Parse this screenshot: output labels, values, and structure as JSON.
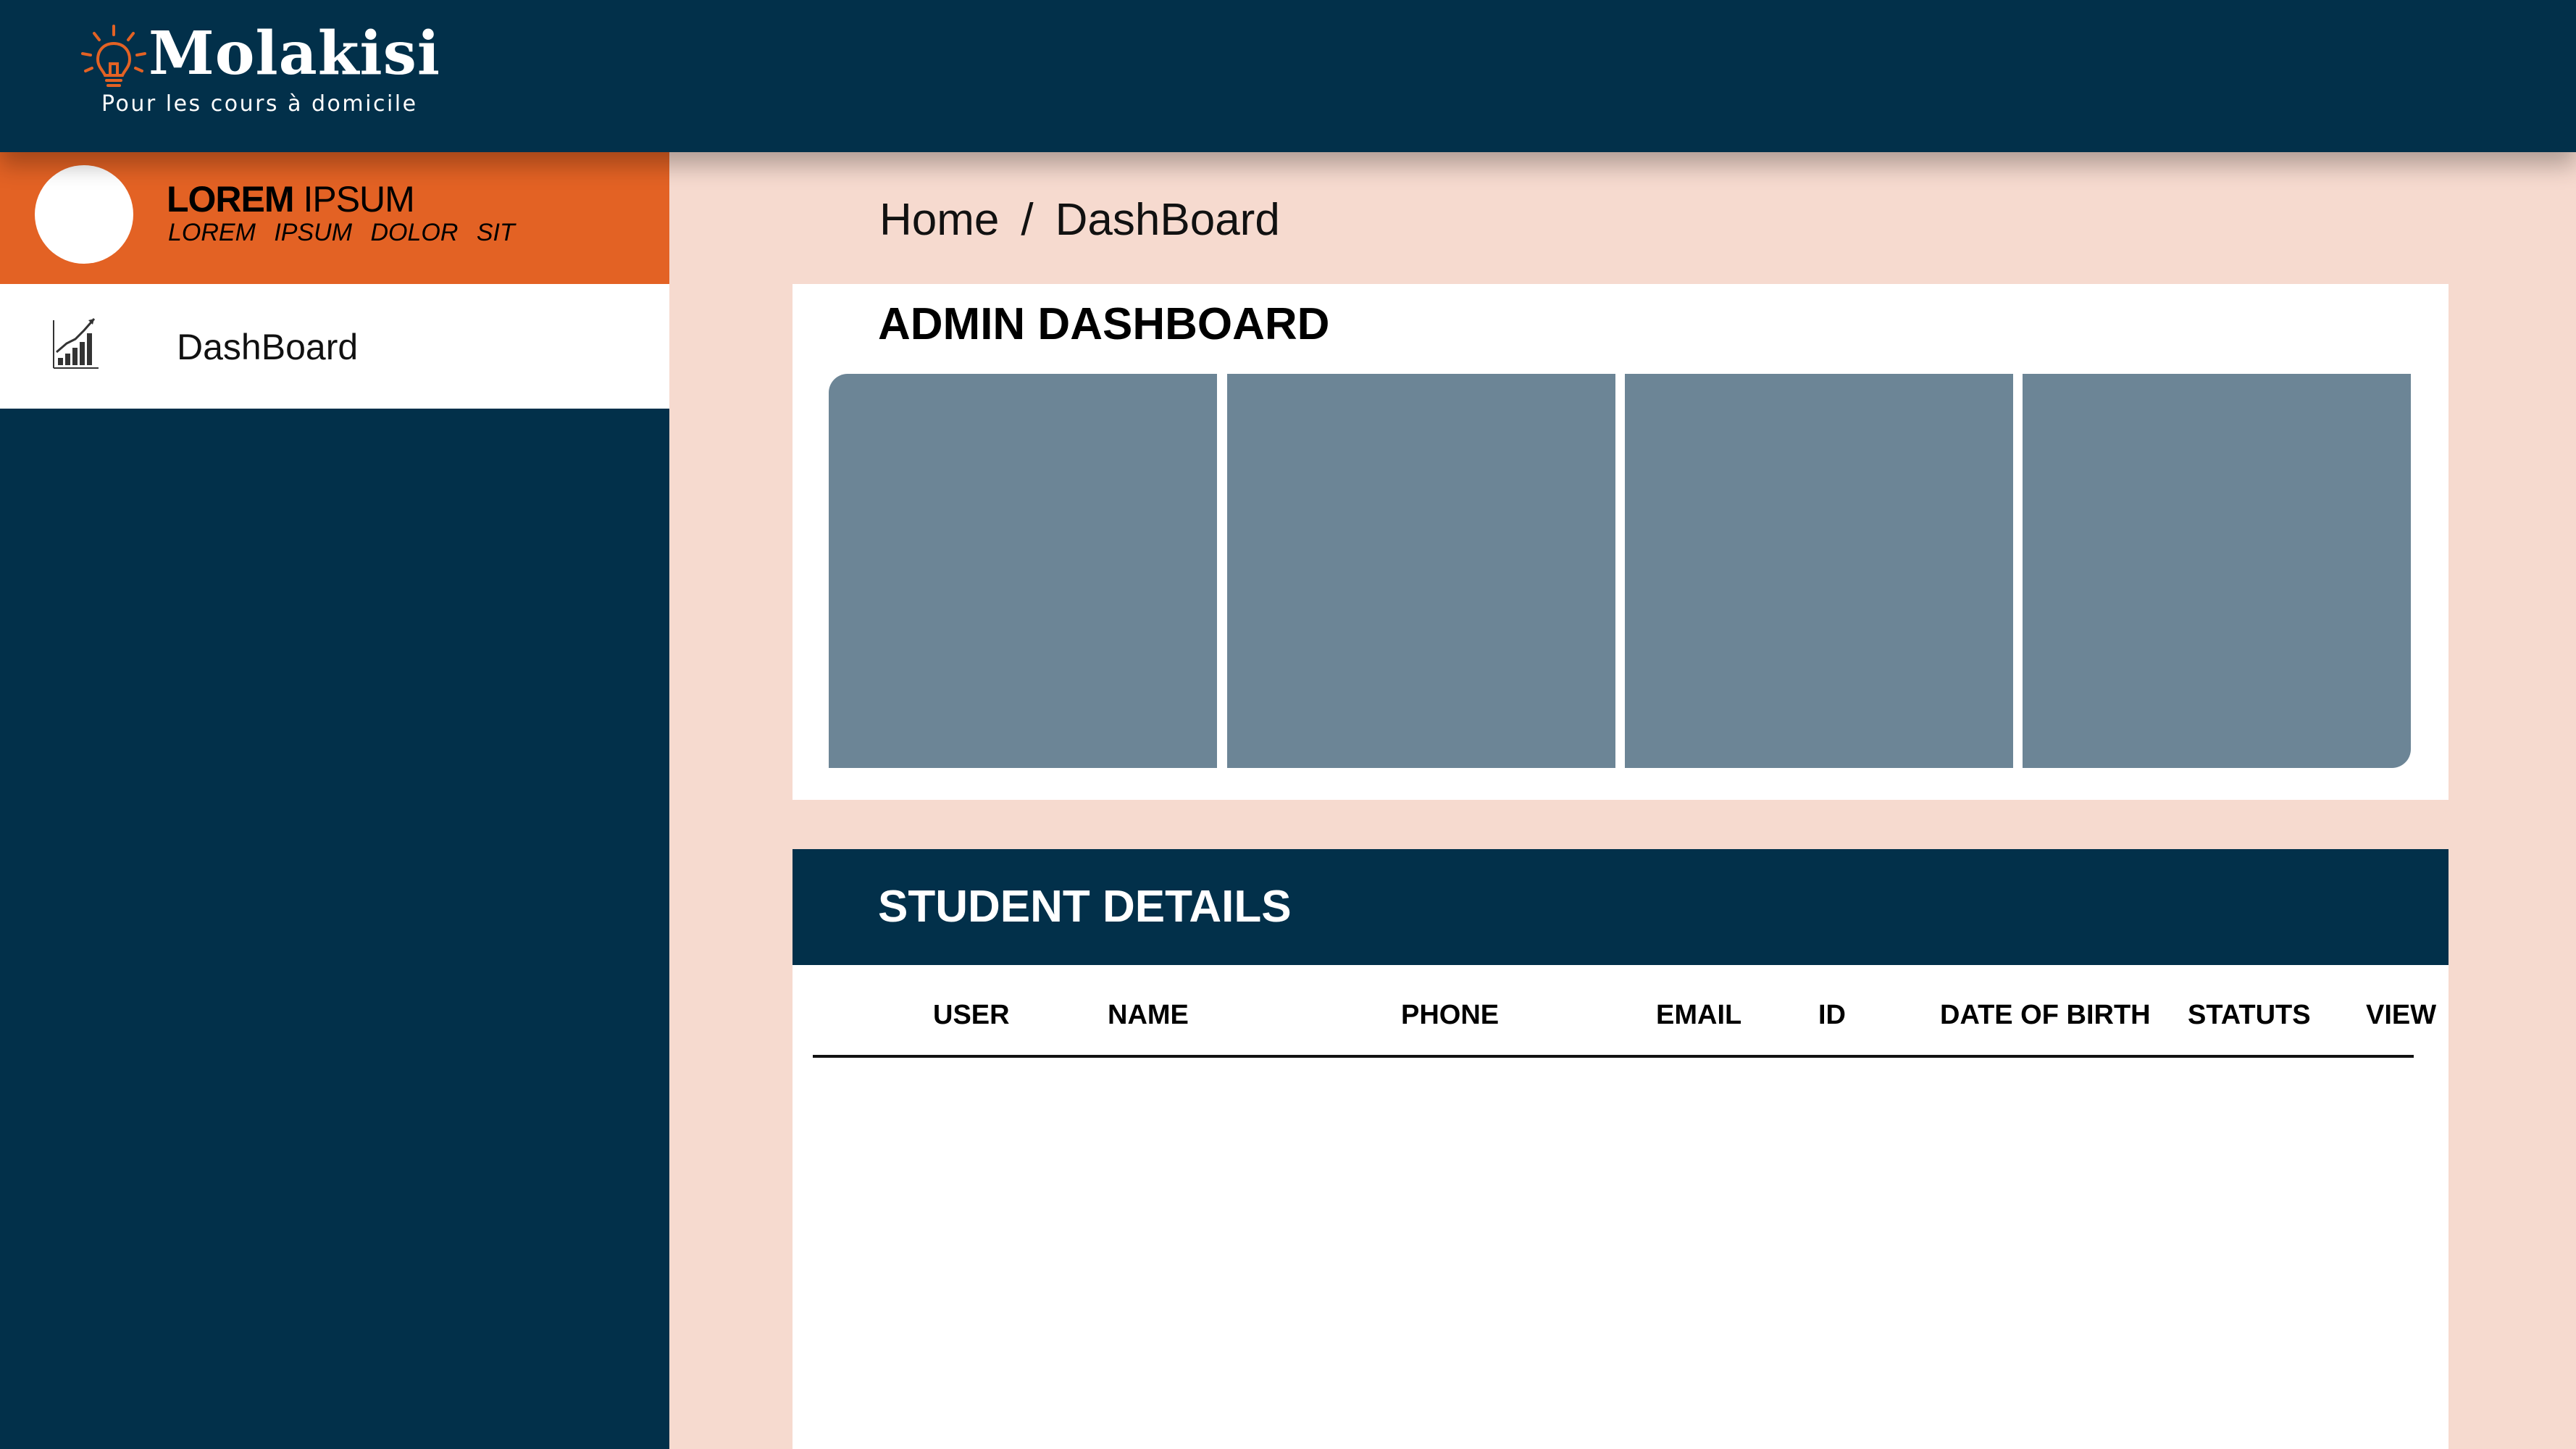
{
  "brand": {
    "name": "Molakisi",
    "tagline": "Pour les cours à domicile",
    "accent_color": "#E36224",
    "primary_color": "#02304A",
    "icon": "lightbulb-icon"
  },
  "profile": {
    "name_bold": "LOREM",
    "name_regular": "IPSUM",
    "subtitle": "LOREM  IPSUM  DOLOR  SIT"
  },
  "sidebar": {
    "items": [
      {
        "label": "DashBoard",
        "icon": "bar-chart-icon"
      }
    ]
  },
  "breadcrumb": {
    "home": "Home",
    "separator": "/",
    "current": "DashBoard"
  },
  "admin": {
    "title": "ADMIN DASHBOARD",
    "tile_color": "#6C8596"
  },
  "students": {
    "title": "STUDENT DETAILS",
    "columns": [
      "USER",
      "NAME",
      "PHONE",
      "EMAIL",
      "ID",
      "DATE OF BIRTH",
      "STATUTS",
      "VIEW"
    ],
    "rows": []
  }
}
